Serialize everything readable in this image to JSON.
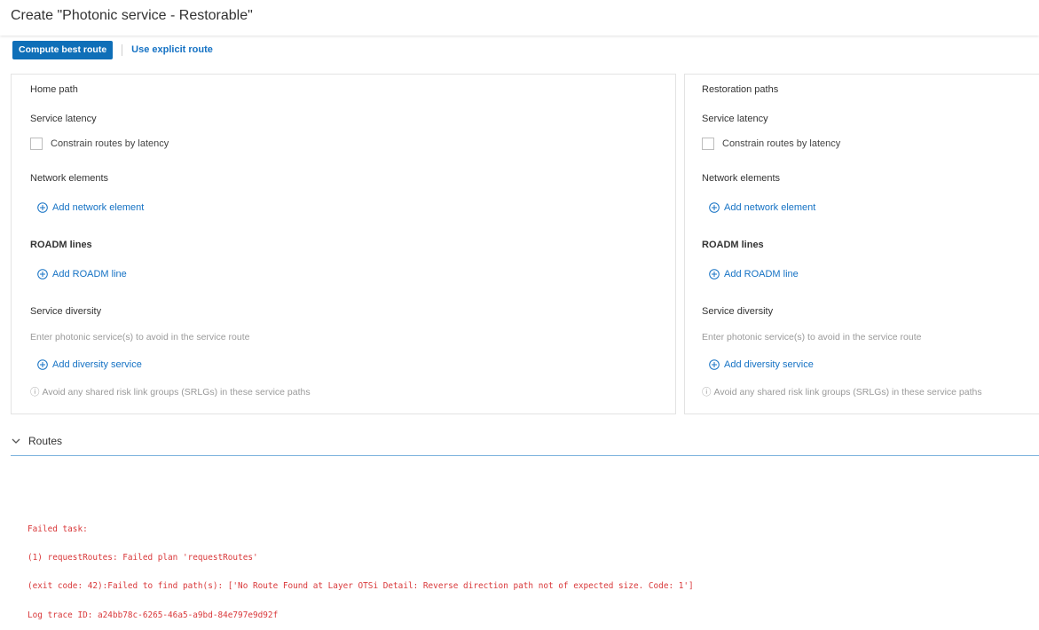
{
  "header": {
    "title": "Create \"Photonic service - Restorable\""
  },
  "toolbar": {
    "compute_label": "Compute best route",
    "explicit_label": "Use explicit route"
  },
  "home": {
    "heading": "Home path",
    "latency_title": "Service latency",
    "latency_checkbox": "Constrain routes by latency",
    "ne_title": "Network elements",
    "ne_add": "Add network element",
    "roadm_title": "ROADM lines",
    "roadm_add": "Add ROADM line",
    "diversity_title": "Service diversity",
    "diversity_hint": "Enter photonic service(s) to avoid in the service route",
    "diversity_add": "Add diversity service",
    "srlg_hint": "Avoid any shared risk link groups (SRLGs) in these service paths"
  },
  "restoration": {
    "heading": "Restoration paths",
    "latency_title": "Service latency",
    "latency_checkbox": "Constrain routes by latency",
    "ne_title": "Network elements",
    "ne_add": "Add network element",
    "roadm_title": "ROADM lines",
    "roadm_add": "Add ROADM line",
    "diversity_title": "Service diversity",
    "diversity_hint": "Enter photonic service(s) to avoid in the service route",
    "diversity_add": "Add diversity service",
    "srlg_hint": "Avoid any shared risk link groups (SRLGs) in these service paths"
  },
  "routes": {
    "label": "Routes",
    "error_lines": [
      "Failed task:",
      "(1) requestRoutes: Failed plan 'requestRoutes'",
      "(exit code: 42):Failed to find path(s): ['No Route Found at Layer OTSi Detail: Reverse direction path not of expected size. Code: 1']",
      "Log trace ID: a24bb78c-6265-46a5-a9bd-84e797e9d92f"
    ]
  },
  "colors": {
    "accent": "#0f6fb8",
    "link": "#1572c4",
    "error": "#d9383a",
    "divider": "#7ab2dd"
  }
}
